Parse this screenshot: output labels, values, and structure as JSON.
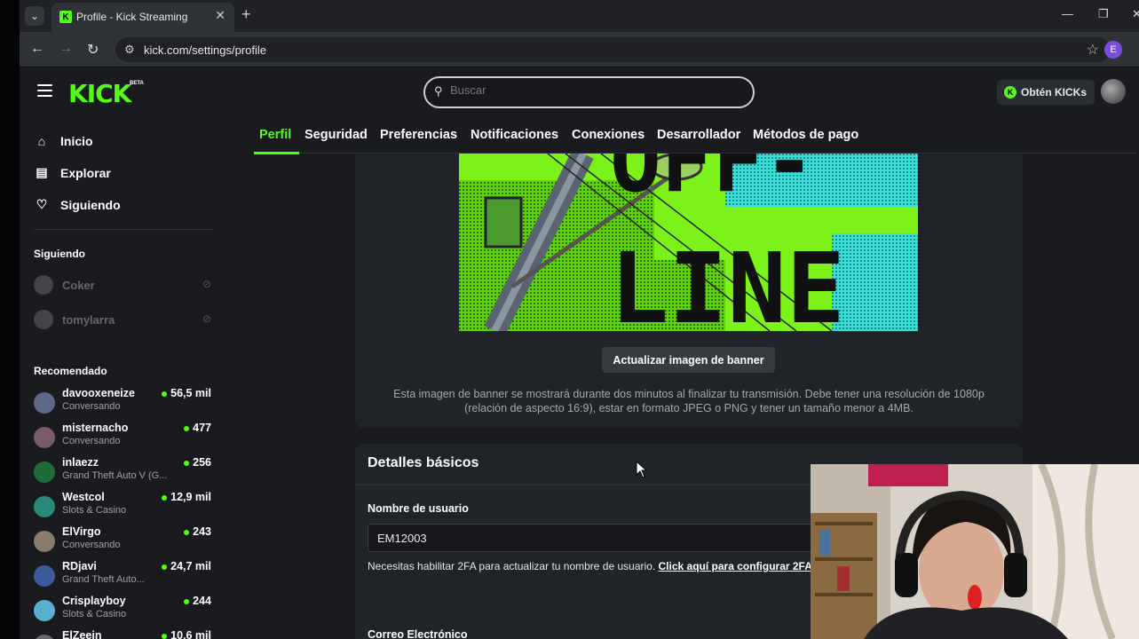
{
  "browser": {
    "tab_title": "Profile - Kick Streaming",
    "tab_favicon": "K",
    "url": "kick.com/settings/profile",
    "profile_initial": "E"
  },
  "header": {
    "logo": "KICK",
    "logo_badge": "BETA",
    "search_placeholder": "Buscar",
    "kicks_label": "Obtén KICKs",
    "kicks_icon": "K"
  },
  "sidebar": {
    "nav": [
      {
        "label": "Inicio",
        "icon": "home-icon"
      },
      {
        "label": "Explorar",
        "icon": "explore-icon"
      },
      {
        "label": "Siguiendo",
        "icon": "heart-icon"
      }
    ],
    "following_heading": "Siguiendo",
    "following": [
      {
        "name": "Coker"
      },
      {
        "name": "tomylarra"
      }
    ],
    "recommended_heading": "Recomendado",
    "recommended": [
      {
        "name": "davooxeneize",
        "category": "Conversando",
        "viewers": "56,5 mil",
        "avatar_color": "#5b6a8a"
      },
      {
        "name": "misternacho",
        "category": "Conversando",
        "viewers": "477",
        "avatar_color": "#7a5a6a"
      },
      {
        "name": "inlaezz",
        "category": "Grand Theft Auto V (G...",
        "viewers": "256",
        "avatar_color": "#1e6b3a"
      },
      {
        "name": "Westcol",
        "category": "Slots & Casino",
        "viewers": "12,9 mil",
        "avatar_color": "#2a8a7a"
      },
      {
        "name": "ElVirgo",
        "category": "Conversando",
        "viewers": "243",
        "avatar_color": "#8a7a6a"
      },
      {
        "name": "RDjavi",
        "category": "Grand Theft Auto...",
        "viewers": "24,7 mil",
        "avatar_color": "#3a5a9a"
      },
      {
        "name": "Crisplayboy",
        "category": "Slots & Casino",
        "viewers": "244",
        "avatar_color": "#5ab0d0"
      },
      {
        "name": "ElZeein",
        "category": "",
        "viewers": "10,6 mil",
        "avatar_color": "#6a6a6a"
      }
    ]
  },
  "settings_tabs": [
    {
      "label": "Perfil",
      "active": true
    },
    {
      "label": "Seguridad",
      "active": false
    },
    {
      "label": "Preferencias",
      "active": false
    },
    {
      "label": "Notificaciones",
      "active": false
    },
    {
      "label": "Conexiones",
      "active": false
    },
    {
      "label": "Desarrollador",
      "active": false
    },
    {
      "label": "Métodos de pago",
      "active": false
    }
  ],
  "banner": {
    "image_text_line1": "OFF-",
    "image_text_line2": "LINE",
    "button_label": "Actualizar imagen de banner",
    "note": "Esta imagen de banner se mostrará durante dos minutos al finalizar tu transmisión. Debe tener una resolución de 1080p (relación de aspecto 16:9), estar en formato JPEG o PNG y tener un tamaño menor a 4MB."
  },
  "basic_details": {
    "title": "Detalles básicos",
    "username_label": "Nombre de usuario",
    "username_value": "EM12003",
    "hint_text": "Necesitas habilitar 2FA para actualizar tu nombre de usuario. ",
    "hint_link": "Click aquí para configurar 2FA",
    "email_label": "Correo Electrónico"
  },
  "colors": {
    "accent": "#53fc18",
    "background": "#191b1f",
    "card": "#202327"
  }
}
